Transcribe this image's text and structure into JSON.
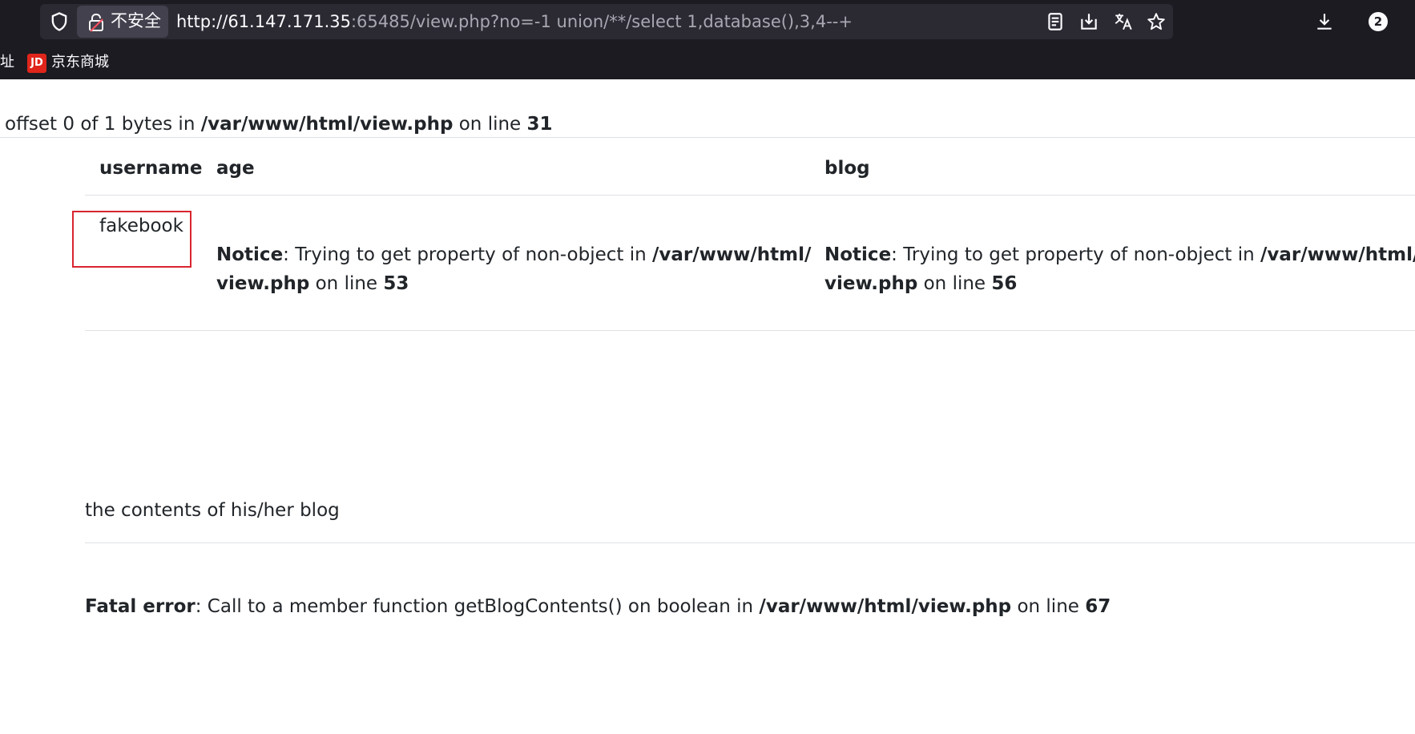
{
  "browser": {
    "insecure_label": "不安全",
    "url_host": "http://61.147.171.35",
    "url_rest": ":65485/view.php?no=-1 union/**/select 1,database(),3,4--+",
    "download_count": "2",
    "bookmarks": {
      "cut_label": "址",
      "jd_logo": "JD",
      "jd_label": "京东商城"
    },
    "icons": [
      "shield-icon",
      "lock-icon",
      "reader-view-icon",
      "save-page-icon",
      "translate-icon",
      "bookmark-star-icon",
      "downloads-icon"
    ],
    "colors": {
      "chrome": "#1c1b22",
      "urlbar": "#2b2a33",
      "jd_red": "#e1251b",
      "highlight_box": "#d9252f"
    }
  },
  "page": {
    "top_notice": {
      "prefix": "offset 0 of 1 bytes in ",
      "path": "/var/www/html/view.php",
      "mid": " on line ",
      "line": "31"
    },
    "table": {
      "headers": {
        "username": "username",
        "age": "age",
        "blog": "blog"
      },
      "username_value": "fakebook",
      "age_notice": {
        "label": "Notice",
        "text": ": Trying to get property of non-object in ",
        "path1": "/var/www/html/",
        "path2": "view.php",
        "mid": " on line ",
        "line": "53"
      },
      "blog_notice": {
        "label": "Notice",
        "text": ": Trying to get property of non-object in ",
        "path1": "/var/www/html/",
        "path2": "view.php",
        "mid": " on line ",
        "line": "56"
      }
    },
    "blog_contents_label": "the contents of his/her blog",
    "fatal_error": {
      "label": "Fatal error",
      "text": ": Call to a member function getBlogContents() on boolean in ",
      "path": "/var/www/html/view.php",
      "mid": " on line ",
      "line": "67"
    }
  }
}
